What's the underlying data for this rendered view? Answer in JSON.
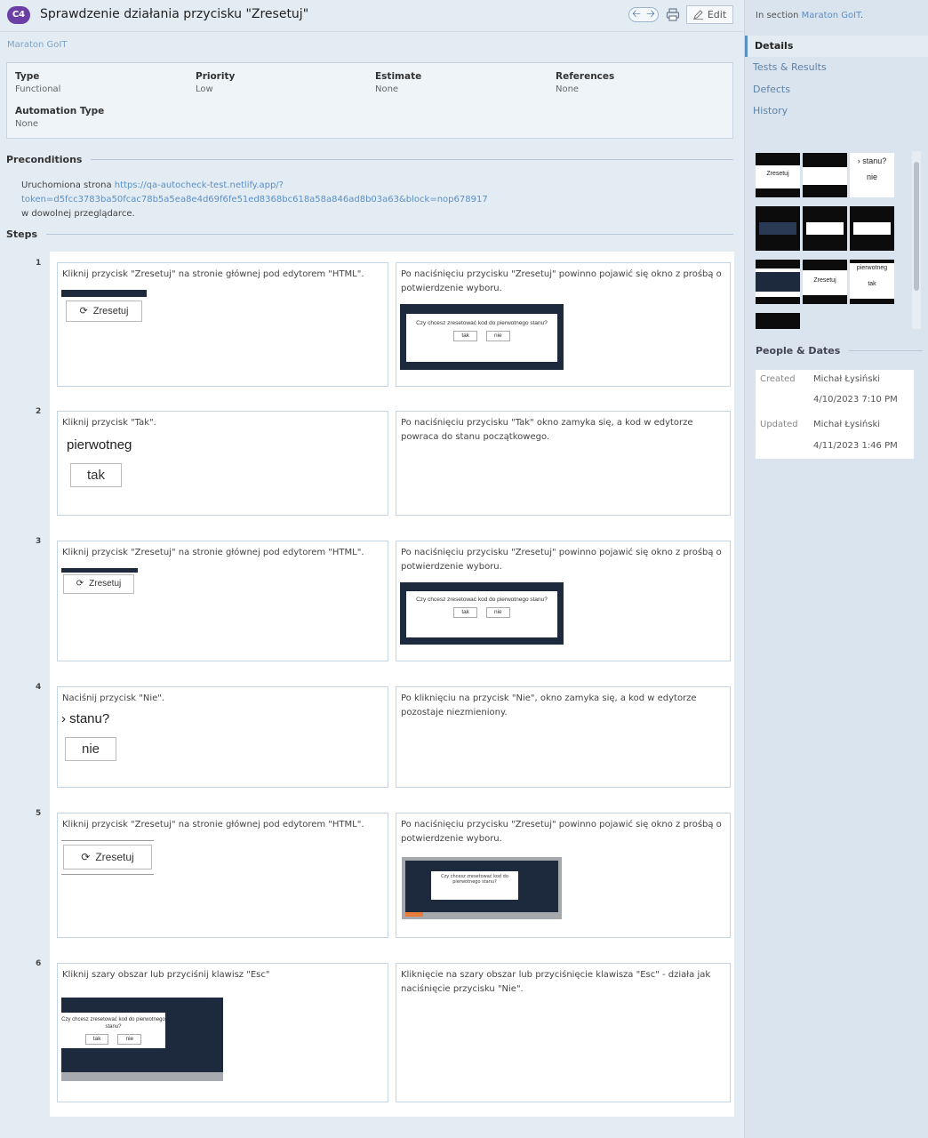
{
  "header": {
    "badge": "C4",
    "title": "Sprawdzenie działania przycisku \"Zresetuj\"",
    "edit_label": "Edit",
    "nav_back": "🡠",
    "nav_fwd": "🡢"
  },
  "breadcrumb": {
    "section": "Maraton GoIT"
  },
  "fields": [
    {
      "label": "Type",
      "value": "Functional"
    },
    {
      "label": "Priority",
      "value": "Low"
    },
    {
      "label": "Estimate",
      "value": "None"
    },
    {
      "label": "References",
      "value": "None"
    },
    {
      "label": "Automation Type",
      "value": "None"
    }
  ],
  "preconditions": {
    "heading": "Preconditions",
    "text_before": "Uruchomiona strona ",
    "url": "https://qa-autocheck-test.netlify.app/?token=d5fcc3783ba50fcac78b5a5ea8e4d69f6fe51ed8368bc618a58a846ad8b03a63&block=nop678917",
    "text_after": "w dowolnej przeglądarce."
  },
  "steps_heading": "Steps",
  "steps": [
    {
      "num": "1",
      "action": "Kliknij przycisk \"Zresetuj\" na stronie głównej pod edytorem \"HTML\".",
      "expected": "Po naciśnięciu przycisku \"Zresetuj\" powinno pojawić się okno z prośbą o potwierdzenie wyboru."
    },
    {
      "num": "2",
      "action": "Kliknij przycisk \"Tak\".",
      "expected": "Po naciśnięciu przycisku \"Tak\" okno zamyka się, a kod w edytorze powraca do stanu początkowego."
    },
    {
      "num": "3",
      "action": "Kliknij przycisk \"Zresetuj\" na stronie głównej pod edytorem \"HTML\".",
      "expected": "Po naciśnięciu przycisku \"Zresetuj\" powinno pojawić się okno z prośbą o potwierdzenie wyboru."
    },
    {
      "num": "4",
      "action": "Naciśnij przycisk \"Nie\".",
      "expected": "Po kliknięciu na przycisk \"Nie\", okno zamyka się, a kod w edytorze pozostaje niezmieniony."
    },
    {
      "num": "5",
      "action": "Kliknij przycisk \"Zresetuj\" na stronie głównej pod edytorem \"HTML\".",
      "expected": "Po naciśnięciu przycisku \"Zresetuj\" powinno pojawić się okno z prośbą o potwierdzenie wyboru."
    },
    {
      "num": "6",
      "action": "Kliknij szary obszar lub przyciśnij klawisz \"Esc\"",
      "expected": "Kliknięcie na szary obszar lub przyciśnięcie klawisza \"Esc\" - działa jak naciśnięcie przycisku \"Nie\"."
    }
  ],
  "screens": {
    "zresetuj": "Zresetuj",
    "dialog_q": "Czy chcesz zresetować kod do pierwotnego stanu?",
    "tak": "tak",
    "nie": "nie",
    "pierwotnego": "pierwotneg",
    "stanu": "› stanu?",
    "stanu_thumb": "› stanu?",
    "pierwotnego_thumb": "pierwotneg"
  },
  "sidebar": {
    "in_section_prefix": "In section ",
    "in_section_link": "Maraton GoIT",
    "in_section_suffix": ".",
    "tabs": [
      "Details",
      "Tests & Results",
      "Defects",
      "History"
    ],
    "people_heading": "People & Dates",
    "created_label": "Created",
    "created_by": "Michał Łysiński",
    "created_at": "4/10/2023 7:10 PM",
    "updated_label": "Updated",
    "updated_by": "Michał Łysiński",
    "updated_at": "4/11/2023 1:46 PM"
  },
  "colors": {
    "badge": "#6b3fa6",
    "link": "#5b8fc5",
    "dark_screen": "#1d2a3d"
  }
}
